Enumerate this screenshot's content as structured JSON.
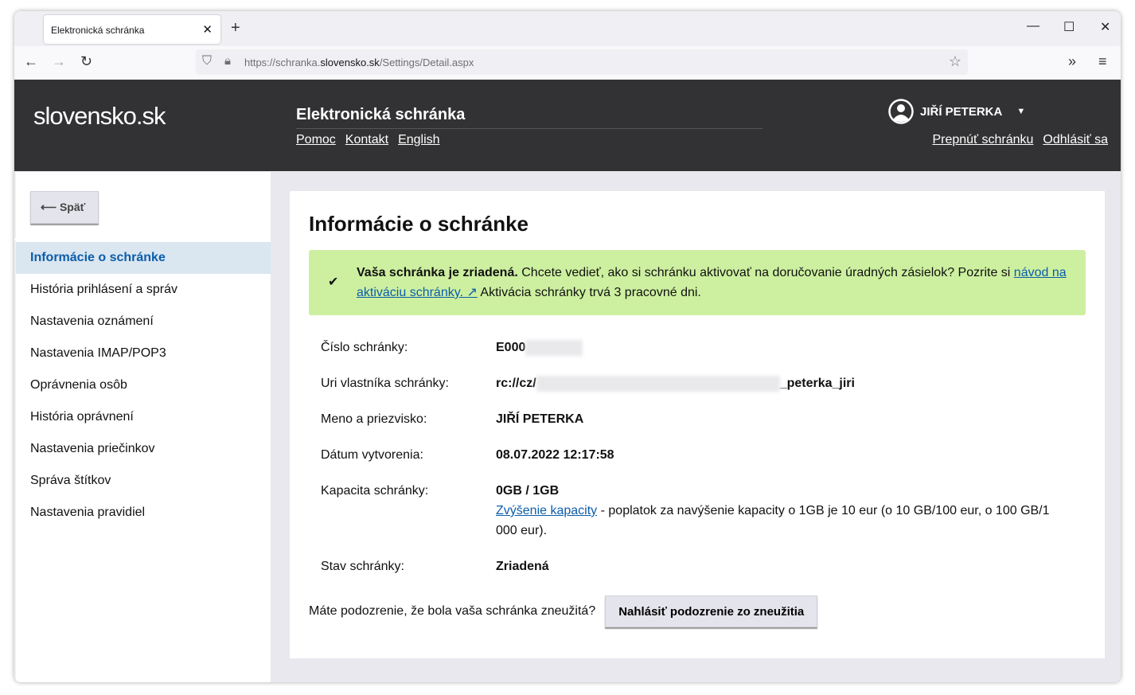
{
  "browser": {
    "tab_title": "Elektronická schránka",
    "url_prefix": "https://schranka.",
    "url_domain": "slovensko.sk",
    "url_path": "/Settings/Detail.aspx"
  },
  "header": {
    "logo": "slovensko.sk",
    "title": "Elektronická schránka",
    "links": [
      "Pomoc",
      "Kontakt",
      "English"
    ],
    "user": "JIŘÍ PETERKA",
    "switch": "Prepnúť schránku",
    "logout": "Odhlásiť sa"
  },
  "sidebar": {
    "back": "Späť",
    "items": [
      "Informácie o schránke",
      "História prihlásení a správ",
      "Nastavenia oznámení",
      "Nastavenia IMAP/POP3",
      "Oprávnenia osôb",
      "História oprávnení",
      "Nastavenia priečinkov",
      "Správa štítkov",
      "Nastavenia pravidiel"
    ]
  },
  "main": {
    "title": "Informácie o schránke",
    "alert": {
      "bold": "Vaša schránka je zriadená.",
      "text": " Chcete vedieť, ako si schránku aktivovať na doručovanie úradných zásielok? Pozrite si ",
      "link": "návod na aktiváciu schránky.",
      "after": " Aktivácia schránky trvá 3 pracovné dni."
    },
    "fields": [
      {
        "label": "Číslo schránky:",
        "value": "E000"
      },
      {
        "label": "Uri vlastníka schránky:",
        "value": "rc://cz/",
        "suffix": "_peterka_jiri"
      },
      {
        "label": "Meno a priezvisko:",
        "value": "JIŘÍ PETERKA"
      },
      {
        "label": "Dátum vytvorenia:",
        "value": "08.07.2022 12:17:58"
      },
      {
        "label": "Kapacita schránky:",
        "value": "0GB / 1GB",
        "link": "Zvýšenie kapacity",
        "note": " - poplatok za navýšenie kapacity o 1GB je 10 eur (o 10 GB/100 eur, o 100 GB/1 000 eur)."
      },
      {
        "label": "Stav schránky:",
        "value": "Zriadená"
      }
    ],
    "report_q": "Máte podozrenie, že bola vaša schránka zneužitá?",
    "report_btn": "Nahlásiť podozrenie zo zneužitia"
  }
}
